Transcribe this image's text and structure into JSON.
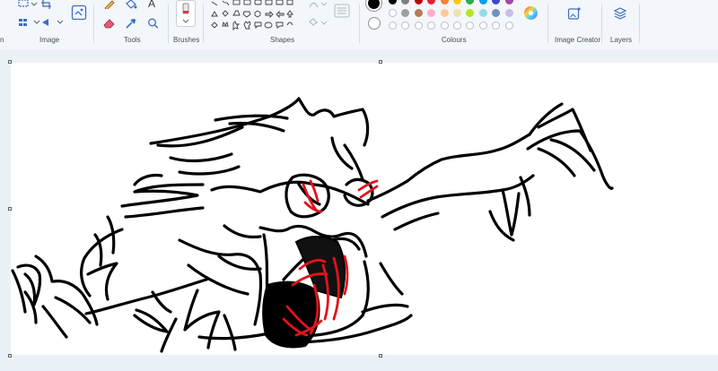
{
  "ribbon": {
    "groups": {
      "image": "Image",
      "tools": "Tools",
      "brushes": "Brushes",
      "shapes": "Shapes",
      "colours": "Colours",
      "image_creator": "Image Creator",
      "layers": "Layers"
    },
    "text_tool_glyph": "A",
    "partial_left_glyph": "n"
  },
  "palette": {
    "primary": "#000000",
    "secondary": "#ffffff",
    "row1": [
      "#000000",
      "#7f7f7f",
      "#c00000",
      "#e81e2d",
      "#ff7f27",
      "#ffc90e",
      "#22b14c",
      "#00a2e8",
      "#3f48cc",
      "#a349a4"
    ],
    "row2": [
      "#ffffff",
      "#a0a0a0",
      "#b97a57",
      "#ffaec9",
      "#ffc99a",
      "#efe4b0",
      "#b5e61d",
      "#99d9ea",
      "#7092be",
      "#c8bfe7"
    ],
    "row3_empty_count": 10
  },
  "icons": [
    "select-icon",
    "crop-icon",
    "rotate-icon",
    "image-resize-icon",
    "pencil-icon",
    "fill-icon",
    "text-icon",
    "eraser-icon",
    "color-picker-icon",
    "magnifier-icon",
    "brush-icon",
    "shapes-gallery-icon",
    "outline-icon",
    "fill-shape-icon",
    "color-wheel-icon",
    "image-creator-icon",
    "layers-icon"
  ]
}
